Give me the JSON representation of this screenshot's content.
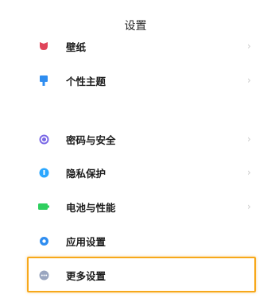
{
  "header": {
    "title": "设置"
  },
  "items": [
    {
      "label": "壁纸",
      "chevron": "›",
      "icon": "wallpaper-icon",
      "color": "#e0455a"
    },
    {
      "label": "个性主题",
      "chevron": "›",
      "icon": "theme-icon",
      "color": "#2f8df0"
    },
    {
      "label": "密码与安全",
      "chevron": "›",
      "icon": "security-icon",
      "color": "#7a68e6"
    },
    {
      "label": "隐私保护",
      "chevron": "›",
      "icon": "privacy-icon",
      "color": "#2aa7ff"
    },
    {
      "label": "电池与性能",
      "chevron": "›",
      "icon": "battery-icon",
      "color": "#2fcf5f"
    },
    {
      "label": "应用设置",
      "chevron": "",
      "icon": "app-settings-icon",
      "color": "#2f8df0"
    },
    {
      "label": "更多设置",
      "chevron": "",
      "icon": "more-settings-icon",
      "color": "#9aa6c0"
    }
  ]
}
